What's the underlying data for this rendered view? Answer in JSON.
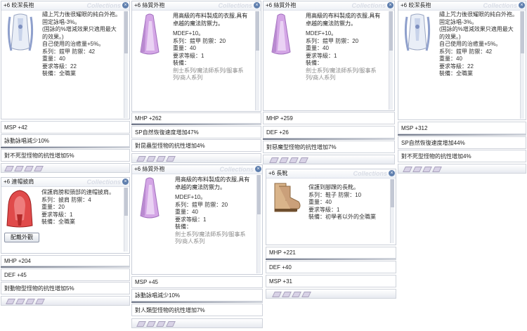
{
  "watermark": "Collections",
  "close_symbol": "×",
  "robe": {
    "title": "+6 皎潔長袍",
    "lines": [
      "繡上咒力後很耀眼的純白外袍。",
      "固定詠唱-3%。",
      "(固詠的%增減效果只適用最大",
      "的效果。)",
      "自己使用的治癒量+5%。",
      "系列：鎧甲 防禦：42",
      "重量：40",
      "要求等級：22",
      "裝備：全職業"
    ]
  },
  "cloak": {
    "title": "+6 絲質外袍",
    "desc": "用高級的布料製成的衣服,具有\n卓越的魔法防禦力。",
    "lines": [
      "MDEF+10。",
      "系列：鎧甲 防禦：20",
      "重量：40",
      "要求等級：1",
      "裝備："
    ],
    "equip": [
      "劍士系列/魔法師系列/服事系",
      "列/商人系列"
    ]
  },
  "hood": {
    "title": "+6 連帽披肩",
    "lines": [
      "保護肩膀和頸部的連帽披肩。",
      "系列：披肩 防禦：4",
      "重量：20",
      "要求等級：1",
      "裝備：全職業"
    ],
    "button": "配戴外觀"
  },
  "boots": {
    "title": "+6 長靴",
    "lines": [
      "保護到腳踝的長靴。",
      "系列：鞋子 防禦：10",
      "重量：40",
      "要求等級：1",
      "裝備：初學者以外的全職業"
    ]
  },
  "bars": {
    "c1": [
      "MSP +42",
      "詠動詠唱減少10%",
      "對不死型怪物的抗性增加5%"
    ],
    "c2": [
      "MHP +262",
      "SP自然恢復速度增加47%",
      "對昆蟲型怪物的抗性增加4%"
    ],
    "c3": [
      "MHP +259",
      "DEF +26",
      "對惡魔型怪物的抗性增加7%"
    ],
    "c4": [
      "MSP +312",
      "SP自然恢復速度增加44%",
      "對不死型怪物的抗性增加4%"
    ],
    "c5": [
      "MHP +204",
      "DEF +45",
      "對動物型怪物的抗性增加5%"
    ],
    "c6": [
      "MSP +45",
      "詠動詠唱減少10%",
      "對人類型怪物的抗性增加7%"
    ],
    "c7": [
      "MHP +221",
      "DEF +40",
      "MSP +31"
    ]
  }
}
